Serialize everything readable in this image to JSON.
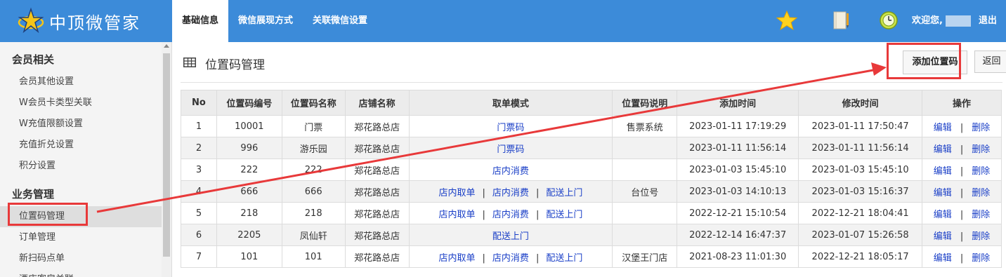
{
  "header": {
    "logo_text": "中顶微管家",
    "nav": [
      "基础信息",
      "微信展现方式",
      "关联微信设置"
    ],
    "welcome": "欢迎您,",
    "logout": "退出",
    "icons": [
      "star-icon",
      "notebook-icon",
      "clock-icon"
    ]
  },
  "sidebar": {
    "groups": [
      {
        "title": "会员相关",
        "items": [
          "会员其他设置",
          "W会员卡类型关联",
          "W充值限额设置",
          "充值折兑设置",
          "积分设置"
        ]
      },
      {
        "title": "业务管理",
        "items": [
          "位置码管理",
          "订单管理",
          "新扫码点单",
          "酒店客房关联"
        ]
      }
    ]
  },
  "main": {
    "title": "位置码管理",
    "add_button": "添加位置码",
    "back_button": "返回"
  },
  "table": {
    "headers": [
      "No",
      "位置码编号",
      "位置码名称",
      "店铺名称",
      "取单模式",
      "位置码说明",
      "添加时间",
      "修改时间",
      "操作"
    ],
    "op_edit": "编辑",
    "op_delete": "删除",
    "rows": [
      {
        "no": "1",
        "code": "10001",
        "name": "门票",
        "store": "郑花路总店",
        "modes": [
          "门票码"
        ],
        "desc": "售票系统",
        "added": "2023-01-11 17:19:29",
        "modified": "2023-01-11 17:50:47"
      },
      {
        "no": "2",
        "code": "996",
        "name": "游乐园",
        "store": "郑花路总店",
        "modes": [
          "门票码"
        ],
        "desc": "",
        "added": "2023-01-11 11:56:14",
        "modified": "2023-01-11 11:56:14"
      },
      {
        "no": "3",
        "code": "222",
        "name": "222",
        "store": "郑花路总店",
        "modes": [
          "店内消费"
        ],
        "desc": "",
        "added": "2023-01-03 15:45:10",
        "modified": "2023-01-03 15:45:10"
      },
      {
        "no": "4",
        "code": "666",
        "name": "666",
        "store": "郑花路总店",
        "modes": [
          "店内取单",
          "店内消费",
          "配送上门"
        ],
        "desc": "台位号",
        "added": "2023-01-03 14:10:13",
        "modified": "2023-01-03 15:16:37"
      },
      {
        "no": "5",
        "code": "218",
        "name": "218",
        "store": "郑花路总店",
        "modes": [
          "店内取单",
          "店内消费",
          "配送上门"
        ],
        "desc": "",
        "added": "2022-12-21 15:10:54",
        "modified": "2022-12-21 18:04:41"
      },
      {
        "no": "6",
        "code": "2205",
        "name": "凤仙轩",
        "store": "郑花路总店",
        "modes": [
          "配送上门"
        ],
        "desc": "",
        "added": "2022-12-14 16:47:37",
        "modified": "2023-01-07 15:26:58"
      },
      {
        "no": "7",
        "code": "101",
        "name": "101",
        "store": "郑花路总店",
        "modes": [
          "店内取单",
          "店内消费",
          "配送上门"
        ],
        "desc": "汉堡王门店",
        "added": "2021-08-23 11:01:30",
        "modified": "2022-12-21 18:05:17"
      }
    ]
  },
  "colors": {
    "header_bg": "#3c8bd9",
    "link": "#1a3fc7",
    "annotation": "#e8393a"
  }
}
